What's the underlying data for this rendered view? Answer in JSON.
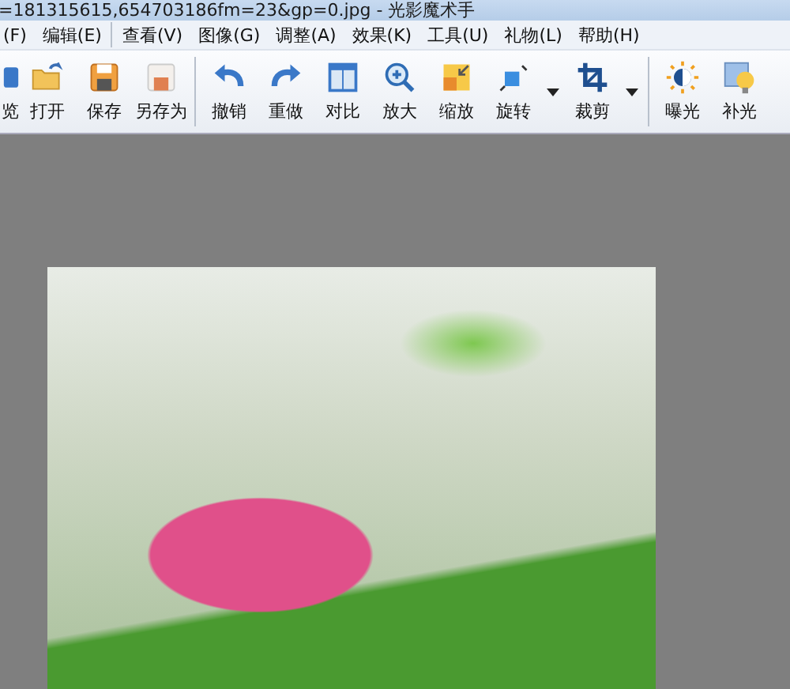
{
  "window": {
    "title": "=181315615,654703186fm=23&gp=0.jpg - 光影魔术手"
  },
  "menu": [
    {
      "label": "(F)"
    },
    {
      "label": "编辑(E)"
    },
    {
      "label": "查看(V)"
    },
    {
      "label": "图像(G)"
    },
    {
      "label": "调整(A)"
    },
    {
      "label": "效果(K)"
    },
    {
      "label": "工具(U)"
    },
    {
      "label": "礼物(L)"
    },
    {
      "label": "帮助(H)"
    }
  ],
  "toolbar": [
    {
      "label": "览",
      "dropdown": false
    },
    {
      "label": "打开",
      "dropdown": false
    },
    {
      "label": "保存",
      "dropdown": false
    },
    {
      "label": "另存为",
      "dropdown": false
    },
    {
      "label": "撤销",
      "dropdown": false
    },
    {
      "label": "重做",
      "dropdown": false
    },
    {
      "label": "对比",
      "dropdown": false
    },
    {
      "label": "放大",
      "dropdown": false
    },
    {
      "label": "缩放",
      "dropdown": false
    },
    {
      "label": "旋转",
      "dropdown": true
    },
    {
      "label": "裁剪",
      "dropdown": true
    },
    {
      "label": "曝光",
      "dropdown": false
    },
    {
      "label": "补光",
      "dropdown": false
    }
  ]
}
